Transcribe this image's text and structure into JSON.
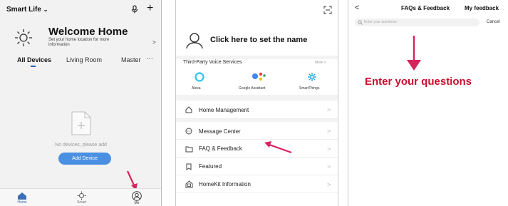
{
  "screen1": {
    "home_title": "Smart Life",
    "welcome_title": "Welcome Home",
    "welcome_sub_line1": "Set your home location for more",
    "welcome_sub_line2": "information",
    "chevron": ">",
    "rooms": [
      "All Devices",
      "Living Room",
      "Master"
    ],
    "more": "···",
    "empty_text": "No devices, please add",
    "add_button": "Add Device",
    "tabs": [
      "Home",
      "Smart",
      "Me"
    ]
  },
  "screen2": {
    "profile_name": "Click here to set the name",
    "voice_title": "Third-Party Voice Services",
    "voice_more": "More >",
    "services": [
      "Alexa",
      "Google Assistant",
      "SmartThings"
    ],
    "menu": [
      "Home Management",
      "Message Center",
      "FAQ & Feedback",
      "Featured",
      "HomeKit Information"
    ],
    "chevron": ">"
  },
  "screen3": {
    "back": "<",
    "tab_faq": "FAQs & Feedback",
    "tab_feedback": "My feedback",
    "search_placeholder": "Enter your questions",
    "cancel": "Cancel",
    "callout": "Enter your questions"
  },
  "colors": {
    "accent_blue": "#4a90e2",
    "arrow": "#d6245c",
    "callout_red": "#c8102e"
  }
}
